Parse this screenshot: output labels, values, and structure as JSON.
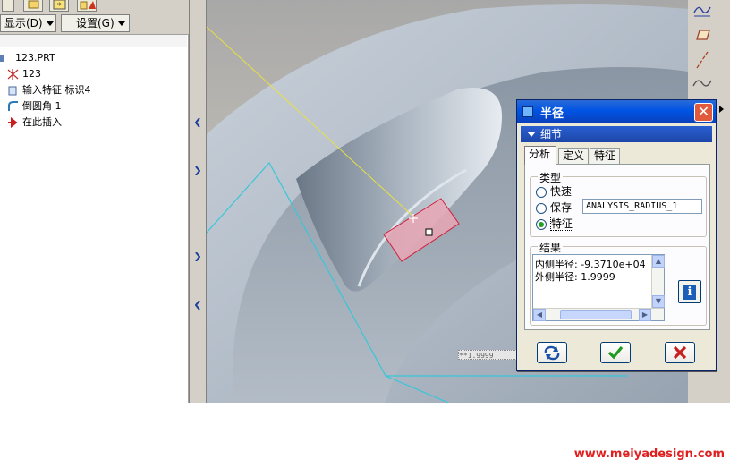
{
  "model_tree": {
    "menu_show": "显示(D)",
    "menu_settings": "设置(G)",
    "items": [
      {
        "label": "123.PRT"
      },
      {
        "label": "123"
      },
      {
        "label": "输入特征 标识4"
      },
      {
        "label": "倒圆角 1"
      },
      {
        "label": "在此插入"
      }
    ]
  },
  "viewport": {
    "dimension_tag": "**1.9999"
  },
  "dialog": {
    "title": "半径",
    "close_glyph": "✕",
    "section": "细节",
    "tabs": [
      "分析",
      "定义",
      "特征"
    ],
    "type_group": {
      "label": "类型",
      "options": [
        "快速",
        "保存",
        "特征"
      ],
      "selected": "特征",
      "save_name": "ANALYSIS_RADIUS_1"
    },
    "results_group": {
      "label": "结果",
      "lines": [
        "内侧半径: -9.3710e+04",
        "外侧半径: 1.9999"
      ]
    },
    "info_glyph": "i"
  },
  "watermark": "www.meiyadesign.com",
  "colors": {
    "title_blue": "#0054e3",
    "accent_red": "#e02020",
    "ok_green": "#1e9a1e",
    "cancel_red": "#c81e1e"
  }
}
